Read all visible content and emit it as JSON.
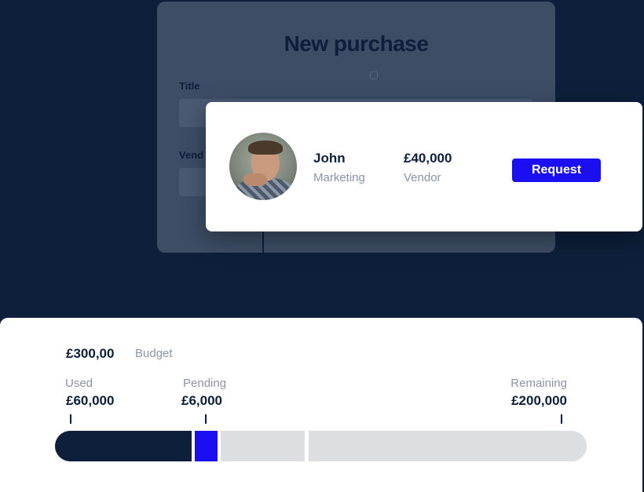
{
  "purchase_form": {
    "title": "New purchase",
    "fields": [
      {
        "label": "Title"
      },
      {
        "label": "Vend"
      }
    ]
  },
  "request_card": {
    "person": {
      "name": "John",
      "department": "Marketing"
    },
    "amount": {
      "value": "£40,000",
      "label": "Vendor"
    },
    "button_label": "Request"
  },
  "budget": {
    "amount": "£300,00",
    "label": "Budget",
    "stats": {
      "used": {
        "label": "Used",
        "value": "£60,000"
      },
      "pending": {
        "label": "Pending",
        "value": "£6,000"
      },
      "remaining": {
        "label": "Remaining",
        "value": "£200,000"
      }
    }
  },
  "colors": {
    "background": "#0d1f3a",
    "accent": "#1b0ff2",
    "muted_text": "#8a94a6",
    "bar_track": "#dcdee2"
  }
}
